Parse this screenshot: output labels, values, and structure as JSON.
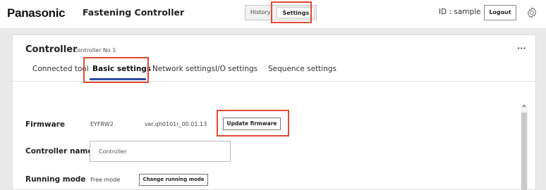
{
  "header": {
    "brand": "Panasonic",
    "app_title": "Fastening Controller",
    "nav": {
      "history_label": "History",
      "settings_label": "Settings"
    },
    "user_id": "ID : sample",
    "logout_label": "Logout",
    "settings_icon": "gear-icon"
  },
  "controller": {
    "title": "Controller",
    "subtitle": "Controller No 1",
    "more_label": "···"
  },
  "tabs": [
    {
      "label": "Connected tool"
    },
    {
      "label": "Basic settings",
      "active": true
    },
    {
      "label": "Network settings"
    },
    {
      "label": "I/O settings"
    },
    {
      "label": "Sequence settings"
    }
  ],
  "firmware": {
    "label": "Firmware",
    "name": "EYFRW2",
    "version": "ver.qh0101r_00.01.13",
    "update_label": "Update firmware"
  },
  "controller_name": {
    "label": "Controller name",
    "value": "Controller"
  },
  "running_mode": {
    "label": "Running mode",
    "value": "Free mode",
    "change_label": "Change running mode"
  },
  "colors": {
    "highlight": "#e04a35",
    "tab_underline": "#2b4aa8",
    "background": "#e9e9e9"
  }
}
